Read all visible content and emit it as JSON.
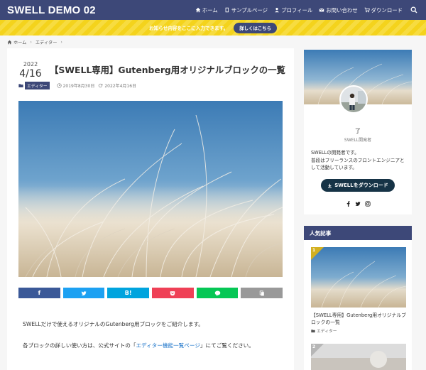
{
  "header": {
    "logo": "SWELL DEMO 02",
    "nav": [
      {
        "label": "ホーム",
        "icon": "home-icon"
      },
      {
        "label": "サンプルページ",
        "icon": "book-icon"
      },
      {
        "label": "プロフィール",
        "icon": "user-icon"
      },
      {
        "label": "お問い合わせ",
        "icon": "mail-icon"
      },
      {
        "label": "ダウンロード",
        "icon": "cart-icon"
      }
    ],
    "search_icon": "search-icon",
    "bg_color": "#3d4878"
  },
  "notice": {
    "text": "お知らせ内容をここに入力できます。",
    "button": "詳しくはこちら",
    "bg_color": "#f4d31c"
  },
  "breadcrumb": {
    "home": "ホーム",
    "category": "エディター"
  },
  "article": {
    "year": "2022",
    "monthday": "4/16",
    "title": "【SWELL専用】Gutenberg用オリジナルブロックの一覧",
    "category": "エディター",
    "published": "2019年8月30日",
    "updated": "2022年4月16日",
    "share": [
      {
        "label": "f",
        "icon": "facebook-icon",
        "color": "#3b5998"
      },
      {
        "label": "",
        "icon": "twitter-icon",
        "color": "#1da1f2"
      },
      {
        "label": "B!",
        "icon": "hatena-icon",
        "color": "#00a4de"
      },
      {
        "label": "",
        "icon": "pocket-icon",
        "color": "#ef4056"
      },
      {
        "label": "",
        "icon": "line-icon",
        "color": "#06c755"
      },
      {
        "label": "",
        "icon": "copy-icon",
        "color": "#999999"
      }
    ],
    "paragraph1": "SWELLだけで使えるオリジナルのGutenberg用ブロックをご紹介します。",
    "paragraph2_before": "各ブロックの詳しい使い方は、公式サイトの「",
    "paragraph2_link": "エディター機能一覧ページ",
    "paragraph2_after": "」にてご覧ください。"
  },
  "profile": {
    "name": "了",
    "role": "SWELL開発者",
    "desc_line1": "SWELLの開発者です。",
    "desc_line2": "普段はフリーランスのフロントエンジニアと",
    "desc_line3": "して活動しています。",
    "download_button": "SWELLをダウンロード",
    "social": [
      "facebook-icon",
      "twitter-icon",
      "instagram-icon"
    ]
  },
  "popular": {
    "heading": "人気記事",
    "items": [
      {
        "rank": "1",
        "title": "【SWELL専用】Gutenberg用オリジナルブロックの一覧",
        "category": "エディター"
      },
      {
        "rank": "2"
      }
    ]
  }
}
